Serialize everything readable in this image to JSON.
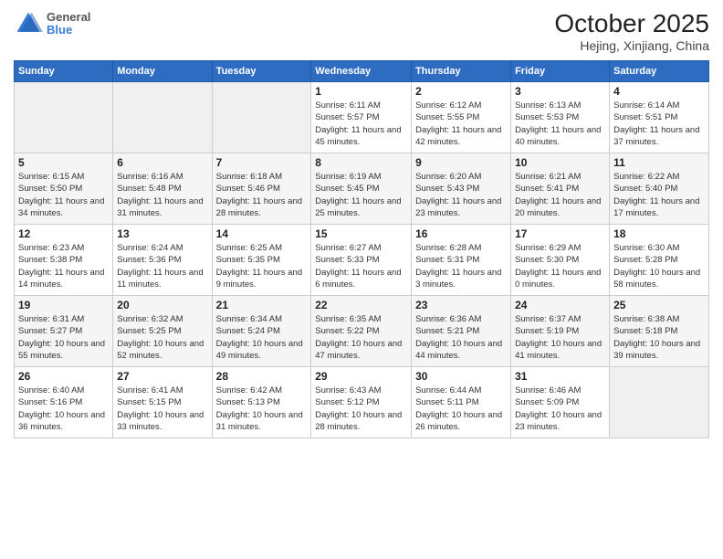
{
  "header": {
    "logo_line1": "General",
    "logo_line2": "Blue",
    "title": "October 2025",
    "subtitle": "Hejing, Xinjiang, China"
  },
  "weekdays": [
    "Sunday",
    "Monday",
    "Tuesday",
    "Wednesday",
    "Thursday",
    "Friday",
    "Saturday"
  ],
  "weeks": [
    [
      {
        "day": "",
        "sunrise": "",
        "sunset": "",
        "daylight": ""
      },
      {
        "day": "",
        "sunrise": "",
        "sunset": "",
        "daylight": ""
      },
      {
        "day": "",
        "sunrise": "",
        "sunset": "",
        "daylight": ""
      },
      {
        "day": "1",
        "sunrise": "Sunrise: 6:11 AM",
        "sunset": "Sunset: 5:57 PM",
        "daylight": "Daylight: 11 hours and 45 minutes."
      },
      {
        "day": "2",
        "sunrise": "Sunrise: 6:12 AM",
        "sunset": "Sunset: 5:55 PM",
        "daylight": "Daylight: 11 hours and 42 minutes."
      },
      {
        "day": "3",
        "sunrise": "Sunrise: 6:13 AM",
        "sunset": "Sunset: 5:53 PM",
        "daylight": "Daylight: 11 hours and 40 minutes."
      },
      {
        "day": "4",
        "sunrise": "Sunrise: 6:14 AM",
        "sunset": "Sunset: 5:51 PM",
        "daylight": "Daylight: 11 hours and 37 minutes."
      }
    ],
    [
      {
        "day": "5",
        "sunrise": "Sunrise: 6:15 AM",
        "sunset": "Sunset: 5:50 PM",
        "daylight": "Daylight: 11 hours and 34 minutes."
      },
      {
        "day": "6",
        "sunrise": "Sunrise: 6:16 AM",
        "sunset": "Sunset: 5:48 PM",
        "daylight": "Daylight: 11 hours and 31 minutes."
      },
      {
        "day": "7",
        "sunrise": "Sunrise: 6:18 AM",
        "sunset": "Sunset: 5:46 PM",
        "daylight": "Daylight: 11 hours and 28 minutes."
      },
      {
        "day": "8",
        "sunrise": "Sunrise: 6:19 AM",
        "sunset": "Sunset: 5:45 PM",
        "daylight": "Daylight: 11 hours and 25 minutes."
      },
      {
        "day": "9",
        "sunrise": "Sunrise: 6:20 AM",
        "sunset": "Sunset: 5:43 PM",
        "daylight": "Daylight: 11 hours and 23 minutes."
      },
      {
        "day": "10",
        "sunrise": "Sunrise: 6:21 AM",
        "sunset": "Sunset: 5:41 PM",
        "daylight": "Daylight: 11 hours and 20 minutes."
      },
      {
        "day": "11",
        "sunrise": "Sunrise: 6:22 AM",
        "sunset": "Sunset: 5:40 PM",
        "daylight": "Daylight: 11 hours and 17 minutes."
      }
    ],
    [
      {
        "day": "12",
        "sunrise": "Sunrise: 6:23 AM",
        "sunset": "Sunset: 5:38 PM",
        "daylight": "Daylight: 11 hours and 14 minutes."
      },
      {
        "day": "13",
        "sunrise": "Sunrise: 6:24 AM",
        "sunset": "Sunset: 5:36 PM",
        "daylight": "Daylight: 11 hours and 11 minutes."
      },
      {
        "day": "14",
        "sunrise": "Sunrise: 6:25 AM",
        "sunset": "Sunset: 5:35 PM",
        "daylight": "Daylight: 11 hours and 9 minutes."
      },
      {
        "day": "15",
        "sunrise": "Sunrise: 6:27 AM",
        "sunset": "Sunset: 5:33 PM",
        "daylight": "Daylight: 11 hours and 6 minutes."
      },
      {
        "day": "16",
        "sunrise": "Sunrise: 6:28 AM",
        "sunset": "Sunset: 5:31 PM",
        "daylight": "Daylight: 11 hours and 3 minutes."
      },
      {
        "day": "17",
        "sunrise": "Sunrise: 6:29 AM",
        "sunset": "Sunset: 5:30 PM",
        "daylight": "Daylight: 11 hours and 0 minutes."
      },
      {
        "day": "18",
        "sunrise": "Sunrise: 6:30 AM",
        "sunset": "Sunset: 5:28 PM",
        "daylight": "Daylight: 10 hours and 58 minutes."
      }
    ],
    [
      {
        "day": "19",
        "sunrise": "Sunrise: 6:31 AM",
        "sunset": "Sunset: 5:27 PM",
        "daylight": "Daylight: 10 hours and 55 minutes."
      },
      {
        "day": "20",
        "sunrise": "Sunrise: 6:32 AM",
        "sunset": "Sunset: 5:25 PM",
        "daylight": "Daylight: 10 hours and 52 minutes."
      },
      {
        "day": "21",
        "sunrise": "Sunrise: 6:34 AM",
        "sunset": "Sunset: 5:24 PM",
        "daylight": "Daylight: 10 hours and 49 minutes."
      },
      {
        "day": "22",
        "sunrise": "Sunrise: 6:35 AM",
        "sunset": "Sunset: 5:22 PM",
        "daylight": "Daylight: 10 hours and 47 minutes."
      },
      {
        "day": "23",
        "sunrise": "Sunrise: 6:36 AM",
        "sunset": "Sunset: 5:21 PM",
        "daylight": "Daylight: 10 hours and 44 minutes."
      },
      {
        "day": "24",
        "sunrise": "Sunrise: 6:37 AM",
        "sunset": "Sunset: 5:19 PM",
        "daylight": "Daylight: 10 hours and 41 minutes."
      },
      {
        "day": "25",
        "sunrise": "Sunrise: 6:38 AM",
        "sunset": "Sunset: 5:18 PM",
        "daylight": "Daylight: 10 hours and 39 minutes."
      }
    ],
    [
      {
        "day": "26",
        "sunrise": "Sunrise: 6:40 AM",
        "sunset": "Sunset: 5:16 PM",
        "daylight": "Daylight: 10 hours and 36 minutes."
      },
      {
        "day": "27",
        "sunrise": "Sunrise: 6:41 AM",
        "sunset": "Sunset: 5:15 PM",
        "daylight": "Daylight: 10 hours and 33 minutes."
      },
      {
        "day": "28",
        "sunrise": "Sunrise: 6:42 AM",
        "sunset": "Sunset: 5:13 PM",
        "daylight": "Daylight: 10 hours and 31 minutes."
      },
      {
        "day": "29",
        "sunrise": "Sunrise: 6:43 AM",
        "sunset": "Sunset: 5:12 PM",
        "daylight": "Daylight: 10 hours and 28 minutes."
      },
      {
        "day": "30",
        "sunrise": "Sunrise: 6:44 AM",
        "sunset": "Sunset: 5:11 PM",
        "daylight": "Daylight: 10 hours and 26 minutes."
      },
      {
        "day": "31",
        "sunrise": "Sunrise: 6:46 AM",
        "sunset": "Sunset: 5:09 PM",
        "daylight": "Daylight: 10 hours and 23 minutes."
      },
      {
        "day": "",
        "sunrise": "",
        "sunset": "",
        "daylight": ""
      }
    ]
  ]
}
